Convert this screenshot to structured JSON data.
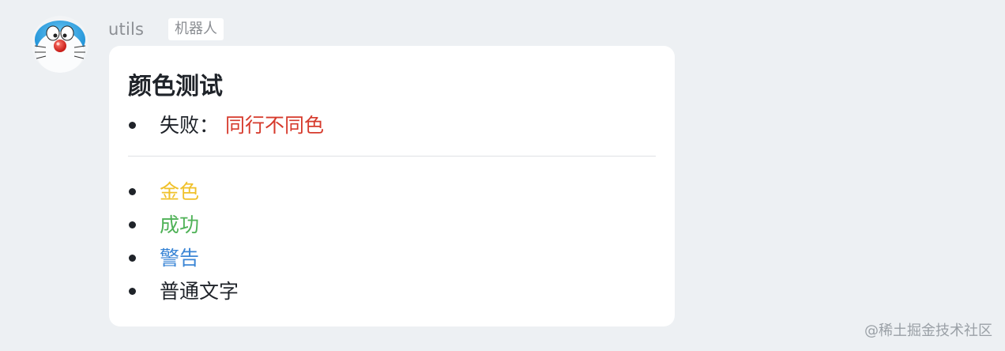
{
  "message": {
    "sender": "utils",
    "badge": "机器人",
    "avatar_icon": "doraemon-avatar-icon"
  },
  "card": {
    "title": "颜色测试",
    "first_list": [
      {
        "prefix": "失败：",
        "text": "同行不同色",
        "color": "#d63a2c"
      }
    ],
    "second_list": [
      {
        "text": "金色",
        "color": "#f0c12a"
      },
      {
        "text": "成功",
        "color": "#4fb257"
      },
      {
        "text": "警告",
        "color": "#3b86d6"
      },
      {
        "text": "普通文字",
        "color": "#1f2329"
      }
    ]
  },
  "watermark": "@稀土掘金技术社区",
  "colors": {
    "background": "#edf0f3",
    "card": "#ffffff",
    "fail": "#d63a2c",
    "gold": "#f0c12a",
    "success": "#4fb257",
    "warning": "#3b86d6"
  }
}
